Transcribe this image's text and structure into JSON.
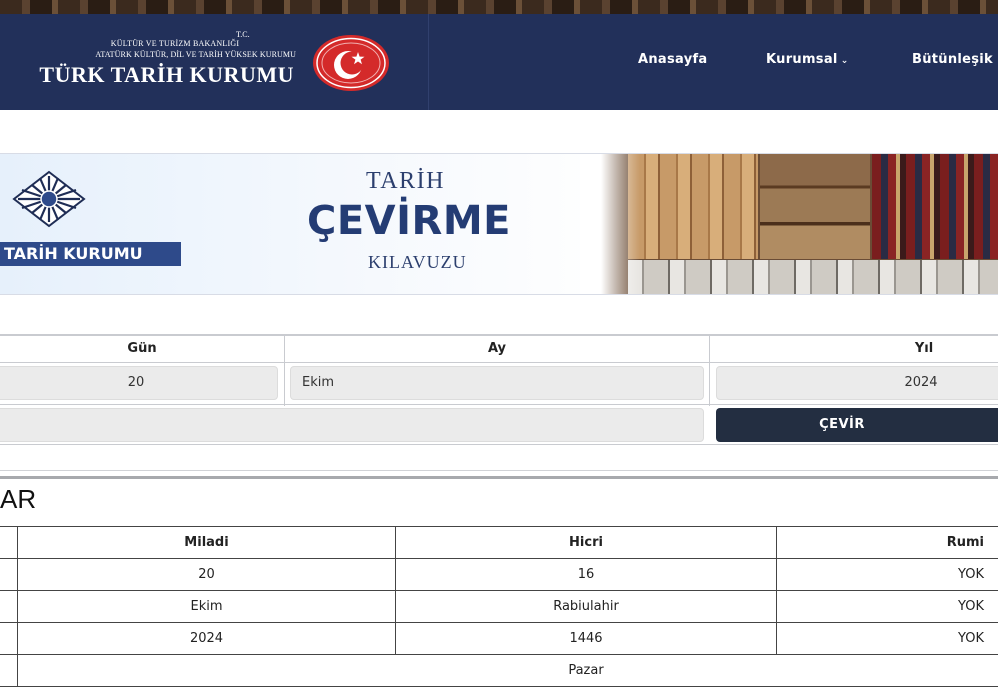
{
  "header": {
    "tc": "T.C.",
    "ministry": "KÜLTÜR VE TURİZM BAKANLIĞI",
    "council": "ATATÜRK KÜLTÜR, DİL VE  TARİH YÜKSEK KURUMU",
    "org_name": "TÜRK TARİH KURUMU",
    "seal_icon": "star-crescent-seal-icon",
    "colors": {
      "bar": "#22305a",
      "seal": "#d42a2a"
    }
  },
  "nav": {
    "home": "Anasayfa",
    "corporate": "Kurumsal",
    "corporate_chevron": "⌄",
    "integrated": "Bütünleşik"
  },
  "banner": {
    "org_label": "TARİH KURUMU",
    "title_top": "TARİH",
    "title_main": "ÇEVİRME",
    "title_bottom": "KILAVUZU",
    "logo_icon": "ttk-logo-icon"
  },
  "form": {
    "day_header": "Gün",
    "month_header": "Ay",
    "year_header": "Yıl",
    "day_value": "20",
    "month_value": "Ekim",
    "year_value": "2024",
    "extra_value": "",
    "convert_label": "ÇEVİR"
  },
  "results": {
    "title": "AR",
    "columns": [
      "Miladi",
      "Hicri",
      "Rumi"
    ],
    "rows": [
      [
        "20",
        "16",
        "YOK"
      ],
      [
        "Ekim",
        "Rabiulahir",
        "YOK"
      ],
      [
        "2024",
        "1446",
        "YOK"
      ]
    ],
    "weekday": "Pazar"
  }
}
